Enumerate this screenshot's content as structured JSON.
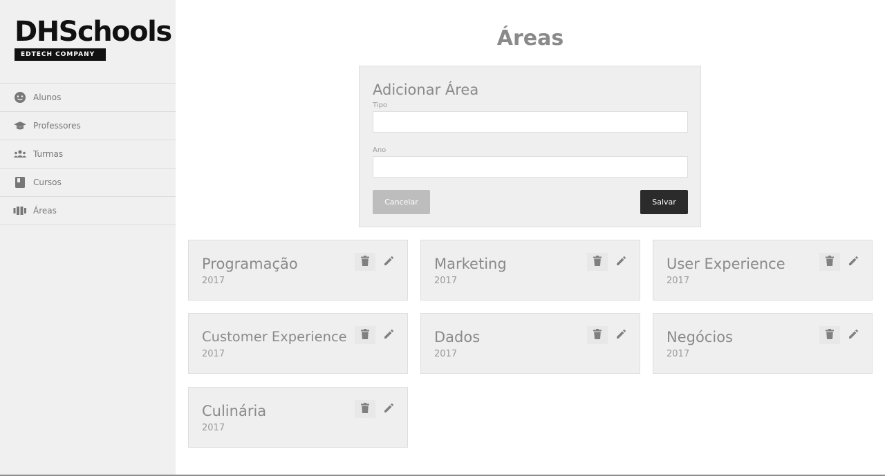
{
  "brand": {
    "name": "DHSchools",
    "tagline": "EDTECH COMPANY"
  },
  "sidebar": {
    "items": [
      {
        "label": "Alunos",
        "icon": "smiley-face-icon"
      },
      {
        "label": "Professores",
        "icon": "graduation-cap-icon"
      },
      {
        "label": "Turmas",
        "icon": "users-group-icon"
      },
      {
        "label": "Cursos",
        "icon": "book-icon"
      },
      {
        "label": "Áreas",
        "icon": "columns-icon"
      }
    ]
  },
  "page": {
    "title": "Áreas"
  },
  "form": {
    "title": "Adicionar Área",
    "tipo_label": "Tipo",
    "tipo_value": "",
    "ano_label": "Ano",
    "ano_value": "",
    "cancel_label": "Cancelar",
    "save_label": "Salvar"
  },
  "areas": [
    {
      "name": "Programação",
      "year": "2017"
    },
    {
      "name": "Marketing",
      "year": "2017"
    },
    {
      "name": "User Experience",
      "year": "2017"
    },
    {
      "name": "Customer Experience",
      "year": "2017"
    },
    {
      "name": "Dados",
      "year": "2017"
    },
    {
      "name": "Negócios",
      "year": "2017"
    },
    {
      "name": "Culinária",
      "year": "2017"
    }
  ],
  "colors": {
    "sidebar_bg": "#f0f0f0",
    "panel_bg": "#efefef",
    "primary_button": "#2b2b2b",
    "disabled_button": "#bdbdbd"
  }
}
